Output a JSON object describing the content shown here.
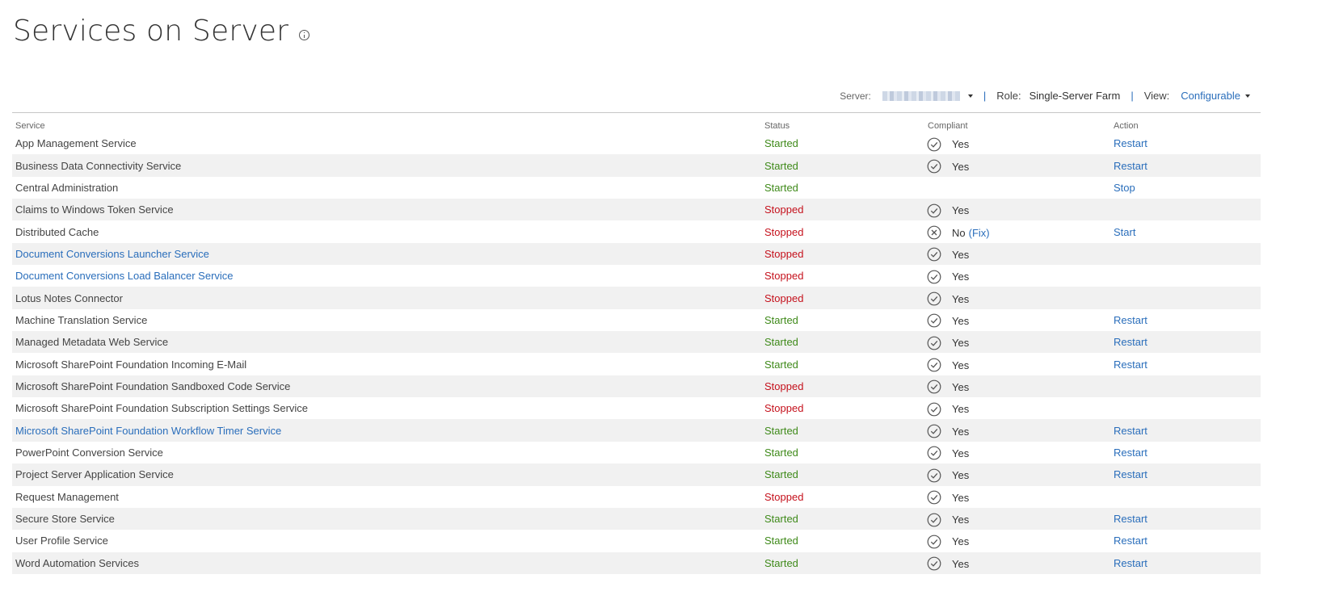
{
  "page": {
    "title": "Services on Server",
    "info_icon": "info-icon"
  },
  "toolbar": {
    "server_label": "Server:",
    "server_value": "",
    "separator": "|",
    "role_label": "Role:",
    "role_value": "Single-Server Farm",
    "view_label": "View:",
    "view_value": "Configurable"
  },
  "table": {
    "headers": {
      "service": "Service",
      "status": "Status",
      "compliant": "Compliant",
      "action": "Action"
    },
    "rows": [
      {
        "service": "App Management Service",
        "service_is_link": false,
        "status": "Started",
        "compliant": "Yes",
        "compliant_icon": "check-icon",
        "fix": "",
        "action": "Restart"
      },
      {
        "service": "Business Data Connectivity Service",
        "service_is_link": false,
        "status": "Started",
        "compliant": "Yes",
        "compliant_icon": "check-icon",
        "fix": "",
        "action": "Restart"
      },
      {
        "service": "Central Administration",
        "service_is_link": false,
        "status": "Started",
        "compliant": "",
        "compliant_icon": "",
        "fix": "",
        "action": "Stop"
      },
      {
        "service": "Claims to Windows Token Service",
        "service_is_link": false,
        "status": "Stopped",
        "compliant": "Yes",
        "compliant_icon": "check-icon",
        "fix": "",
        "action": ""
      },
      {
        "service": "Distributed Cache",
        "service_is_link": false,
        "status": "Stopped",
        "compliant": "No",
        "compliant_icon": "x-icon",
        "fix": "(Fix)",
        "action": "Start"
      },
      {
        "service": "Document Conversions Launcher Service",
        "service_is_link": true,
        "status": "Stopped",
        "compliant": "Yes",
        "compliant_icon": "check-icon",
        "fix": "",
        "action": ""
      },
      {
        "service": "Document Conversions Load Balancer Service",
        "service_is_link": true,
        "status": "Stopped",
        "compliant": "Yes",
        "compliant_icon": "check-icon",
        "fix": "",
        "action": ""
      },
      {
        "service": "Lotus Notes Connector",
        "service_is_link": false,
        "status": "Stopped",
        "compliant": "Yes",
        "compliant_icon": "check-icon",
        "fix": "",
        "action": ""
      },
      {
        "service": "Machine Translation Service",
        "service_is_link": false,
        "status": "Started",
        "compliant": "Yes",
        "compliant_icon": "check-icon",
        "fix": "",
        "action": "Restart"
      },
      {
        "service": "Managed Metadata Web Service",
        "service_is_link": false,
        "status": "Started",
        "compliant": "Yes",
        "compliant_icon": "check-icon",
        "fix": "",
        "action": "Restart"
      },
      {
        "service": "Microsoft SharePoint Foundation Incoming E-Mail",
        "service_is_link": false,
        "status": "Started",
        "compliant": "Yes",
        "compliant_icon": "check-icon",
        "fix": "",
        "action": "Restart"
      },
      {
        "service": "Microsoft SharePoint Foundation Sandboxed Code Service",
        "service_is_link": false,
        "status": "Stopped",
        "compliant": "Yes",
        "compliant_icon": "check-icon",
        "fix": "",
        "action": ""
      },
      {
        "service": "Microsoft SharePoint Foundation Subscription Settings Service",
        "service_is_link": false,
        "status": "Stopped",
        "compliant": "Yes",
        "compliant_icon": "check-icon",
        "fix": "",
        "action": ""
      },
      {
        "service": "Microsoft SharePoint Foundation Workflow Timer Service",
        "service_is_link": true,
        "status": "Started",
        "compliant": "Yes",
        "compliant_icon": "check-icon",
        "fix": "",
        "action": "Restart"
      },
      {
        "service": "PowerPoint Conversion Service",
        "service_is_link": false,
        "status": "Started",
        "compliant": "Yes",
        "compliant_icon": "check-icon",
        "fix": "",
        "action": "Restart"
      },
      {
        "service": "Project Server Application Service",
        "service_is_link": false,
        "status": "Started",
        "compliant": "Yes",
        "compliant_icon": "check-icon",
        "fix": "",
        "action": "Restart"
      },
      {
        "service": "Request Management",
        "service_is_link": false,
        "status": "Stopped",
        "compliant": "Yes",
        "compliant_icon": "check-icon",
        "fix": "",
        "action": ""
      },
      {
        "service": "Secure Store Service",
        "service_is_link": false,
        "status": "Started",
        "compliant": "Yes",
        "compliant_icon": "check-icon",
        "fix": "",
        "action": "Restart"
      },
      {
        "service": "User Profile Service",
        "service_is_link": false,
        "status": "Started",
        "compliant": "Yes",
        "compliant_icon": "check-icon",
        "fix": "",
        "action": "Restart"
      },
      {
        "service": "Word Automation Services",
        "service_is_link": false,
        "status": "Started",
        "compliant": "Yes",
        "compliant_icon": "check-icon",
        "fix": "",
        "action": "Restart"
      }
    ]
  },
  "colors": {
    "link": "#2a6ebb",
    "started": "#3f8a1a",
    "stopped": "#c5111c",
    "row_alt": "#f1f1f1"
  }
}
